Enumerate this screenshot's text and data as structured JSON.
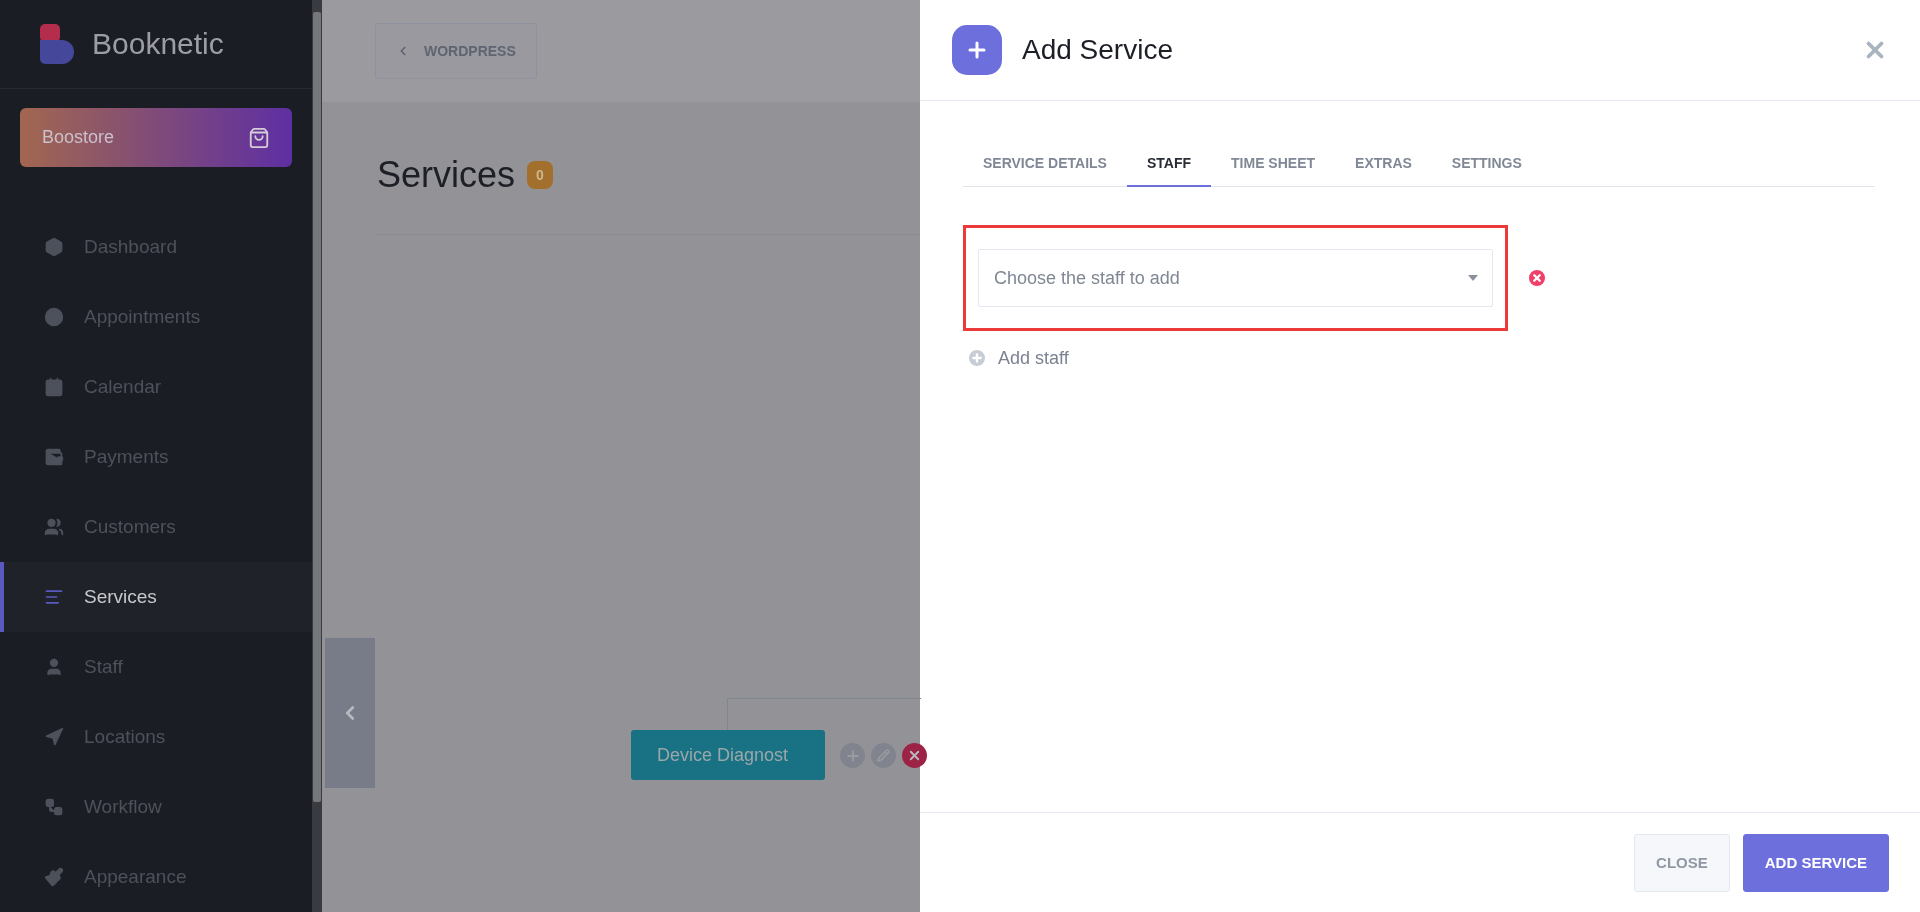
{
  "sidebar": {
    "brand": "Booknetic",
    "store_button": "Boostore",
    "items": [
      {
        "label": "Dashboard",
        "selected": false
      },
      {
        "label": "Appointments",
        "selected": false
      },
      {
        "label": "Calendar",
        "selected": false
      },
      {
        "label": "Payments",
        "selected": false
      },
      {
        "label": "Customers",
        "selected": false
      },
      {
        "label": "Services",
        "selected": true
      },
      {
        "label": "Staff",
        "selected": false
      },
      {
        "label": "Locations",
        "selected": false
      },
      {
        "label": "Workflow",
        "selected": false
      },
      {
        "label": "Appearance",
        "selected": false
      }
    ]
  },
  "page": {
    "back_button": "WORDPRESS",
    "title": "Services",
    "count": "0",
    "nodes": [
      {
        "label": "Device Diagnost"
      }
    ]
  },
  "modal": {
    "title": "Add Service",
    "tabs": [
      {
        "label": "SERVICE DETAILS",
        "selected": false
      },
      {
        "label": "STAFF",
        "selected": true
      },
      {
        "label": "TIME SHEET",
        "selected": false
      },
      {
        "label": "EXTRAS",
        "selected": false
      },
      {
        "label": "SETTINGS",
        "selected": false
      }
    ],
    "staff_select": {
      "placeholder": "Choose the staff to add"
    },
    "add_staff": "Add staff",
    "buttons": {
      "close": "CLOSE",
      "submit": "ADD SERVICE"
    }
  }
}
